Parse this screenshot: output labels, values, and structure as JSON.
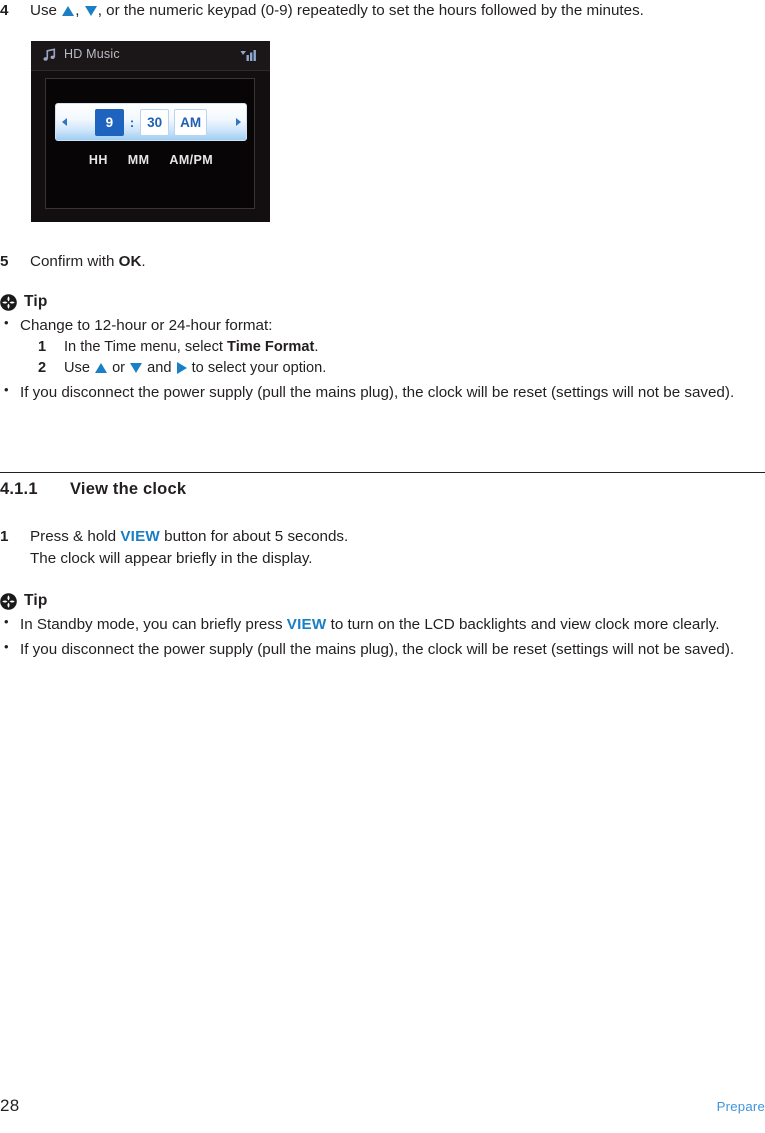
{
  "step4": {
    "number": "4",
    "text_before": "Use ",
    "text_mid": ", or the numeric keypad (0-9) repeatedly to set the hours followed by the minutes.",
    "comma": ", "
  },
  "device": {
    "title": "HD Music",
    "note_icon": "music-note-icon",
    "signal_icon": "signal-bars-icon",
    "left_arrow": "left-arrow-icon",
    "right_arrow": "right-arrow-icon",
    "hours_value": "9",
    "separator": ":",
    "minutes_value": "30",
    "meridiem_value": "AM",
    "label_hours": "HH",
    "label_minutes": "MM",
    "label_meridiem": "AM/PM",
    "selected_color": "#1e63bd",
    "title_color": "#b9bcc6"
  },
  "step5": {
    "number": "5",
    "text_before": "Confirm with ",
    "bold": "OK",
    "text_after": "."
  },
  "tip1": {
    "icon": "tip-asterisk-icon",
    "label": "Tip",
    "bullet1_text": "Change to 12-hour or 24-hour format:",
    "substep1": {
      "number": "1",
      "text_before": "In the Time menu, select ",
      "bold": "Time Format",
      "text_after": "."
    },
    "substep2": {
      "number": "2",
      "text_before": "Use ",
      "text_or": " or ",
      "text_and": " and ",
      "text_after": " to select your option."
    },
    "bullet2_text": "If you disconnect the power supply (pull the mains plug), the clock will be reset (settings will not be saved)."
  },
  "section": {
    "number": "4.1.1",
    "title": "View the clock"
  },
  "step1": {
    "number": "1",
    "text_before": "Press & hold ",
    "blue": "VIEW",
    "text_after": " button for about 5 seconds.",
    "line2": "The clock will appear briefly in the display."
  },
  "tip2": {
    "icon": "tip-asterisk-icon",
    "label": "Tip",
    "bullet1_before": "In Standby mode, you can briefly press ",
    "bullet1_blue": "VIEW",
    "bullet1_after": " to turn on the LCD backlights and view clock more clearly.",
    "bullet2_text": "If you disconnect the power supply (pull the mains plug), the clock will be reset (settings will not be saved)."
  },
  "footer": {
    "page_number": "28",
    "section_label": "Prepare",
    "section_label_color": "#3d94dd"
  },
  "colors": {
    "accent_blue": "#1a7fc4",
    "text": "#231f20",
    "footer_blue": "#3d94dd"
  }
}
